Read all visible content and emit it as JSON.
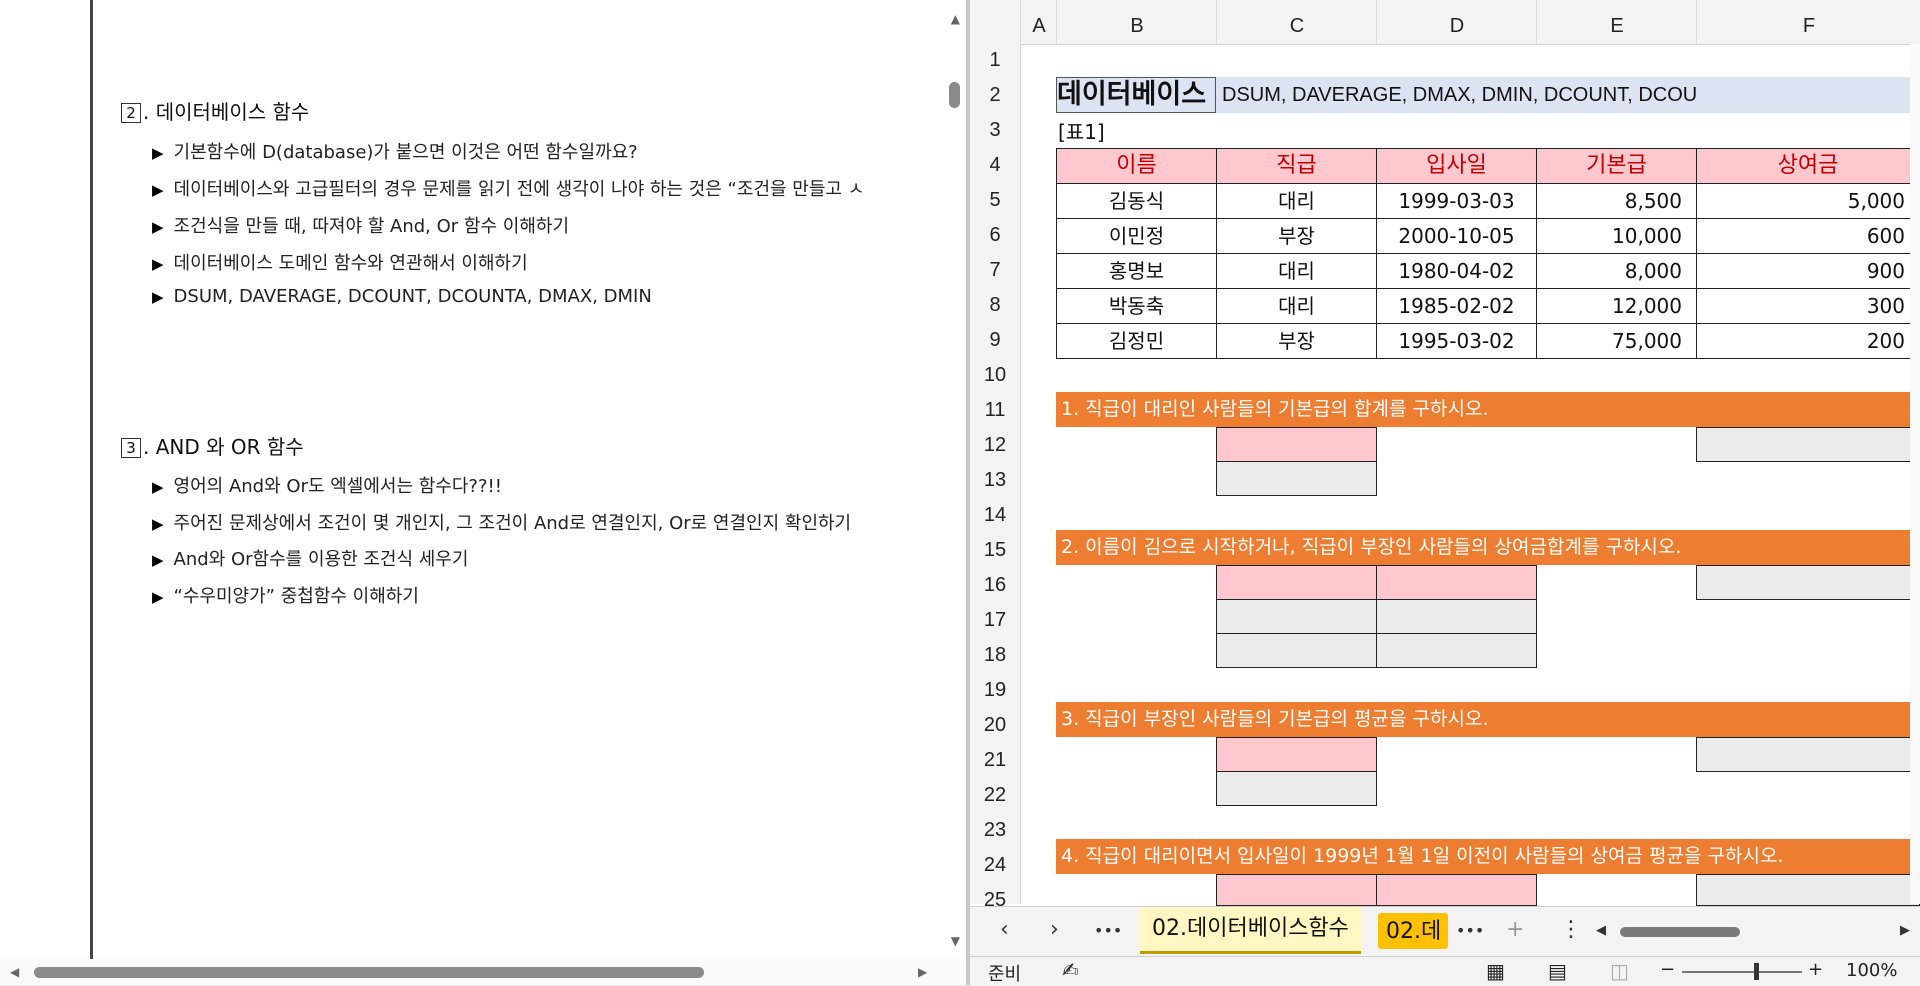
{
  "document": {
    "sections": [
      {
        "number": "2",
        "title": "데이터베이스 함수",
        "bullets": [
          "기본함수에 D(database)가 붙으면 이것은 어떤 함수일까요?",
          "데이터베이스와 고급필터의 경우 문제를 읽기 전에 생각이 나야 하는 것은 “조건을 만들고 ㅅ",
          "조건식을 만들 때, 따져야 할 And, Or 함수 이해하기",
          "데이터베이스 도메인 함수와 연관해서 이해하기",
          "DSUM, DAVERAGE, DCOUNT, DCOUNTA, DMAX, DMIN"
        ]
      },
      {
        "number": "3",
        "title": "AND 와 OR 함수",
        "bullets": [
          "영어의 And와 Or도 엑셀에서는 함수다??!!",
          "주어진 문제상에서 조건이 몇 개인지, 그 조건이 And로 연결인지, Or로 연결인지 확인하기",
          "And와 Or함수를 이용한 조건식 세우기",
          "“수우미양가” 중첩함수 이해하기"
        ]
      }
    ],
    "bullet_marker": "▶"
  },
  "sheet": {
    "columns": [
      "A",
      "B",
      "C",
      "D",
      "E",
      "F"
    ],
    "rows": [
      "1",
      "2",
      "3",
      "4",
      "5",
      "6",
      "7",
      "8",
      "9",
      "10",
      "11",
      "12",
      "13",
      "14",
      "15",
      "16",
      "17",
      "18",
      "19",
      "20",
      "21",
      "22",
      "23",
      "24",
      "25"
    ],
    "title": "데이터베이스 함수",
    "title_note": "DSUM, DAVERAGE, DMAX, DMIN, DCOUNT, DCOU",
    "table_label": "[표1]",
    "table": {
      "headers": [
        "이름",
        "직급",
        "입사일",
        "기본급",
        "상여금"
      ],
      "rows": [
        [
          "김동식",
          "대리",
          "1999-03-03",
          "8,500",
          "5,000"
        ],
        [
          "이민정",
          "부장",
          "2000-10-05",
          "10,000",
          "600"
        ],
        [
          "홍명보",
          "대리",
          "1980-04-02",
          "8,000",
          "900"
        ],
        [
          "박동축",
          "대리",
          "1985-02-02",
          "12,000",
          "300"
        ],
        [
          "김정민",
          "부장",
          "1995-03-02",
          "75,000",
          "200"
        ]
      ]
    },
    "questions": [
      "1. 직급이 대리인 사람들의 기본급의 합계를 구하시오.",
      "2. 이름이 김으로 시작하거나, 직급이 부장인 사람들의 상여금합계를 구하시오.",
      "3. 직급이 부장인 사람들의 기본급의 평균을 구하시오.",
      "4. 직급이 대리이면서 입사일이 1999년 1월 1일 이전이 사람들의 상여금 평균을 구하시오."
    ],
    "tabs": {
      "active": "02.데이터베이스함수",
      "second": "02.데"
    },
    "status": {
      "ready": "준비",
      "zoom": "100%"
    },
    "icons": {
      "prev_sheet": "‹",
      "next_sheet": "›",
      "more": "•••",
      "add_sheet": "+",
      "options": "⋮",
      "minus": "−",
      "plus": "+"
    }
  }
}
